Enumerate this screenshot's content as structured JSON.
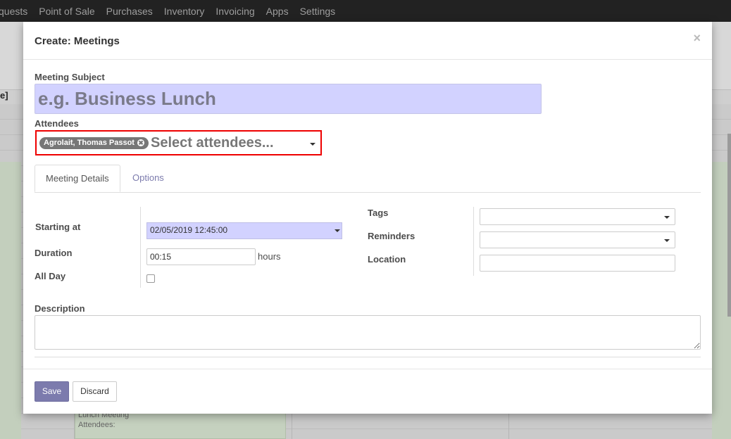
{
  "topnav": {
    "items": [
      "quests",
      "Point of Sale",
      "Purchases",
      "Inventory",
      "Invoicing",
      "Apps",
      "Settings"
    ]
  },
  "background": {
    "bracket_text": "e]",
    "event_title": "Lunch Meeting",
    "event_attendees": "Attendees:"
  },
  "dialog": {
    "title": "Create: Meetings",
    "close": "×",
    "meeting_subject": {
      "label": "Meeting Subject",
      "placeholder": "e.g. Business Lunch",
      "value": ""
    },
    "attendees": {
      "label": "Attendees",
      "tags": [
        "Agrolait, Thomas Passot"
      ],
      "placeholder": "Select attendees..."
    },
    "tabs": [
      {
        "label": "Meeting Details",
        "active": true
      },
      {
        "label": "Options",
        "active": false
      }
    ],
    "starting_at": {
      "label": "Starting at",
      "value": "02/05/2019 12:45:00"
    },
    "duration": {
      "label": "Duration",
      "value": "00:15",
      "unit": "hours"
    },
    "all_day": {
      "label": "All Day",
      "checked": false
    },
    "tags_field": {
      "label": "Tags",
      "value": ""
    },
    "reminders": {
      "label": "Reminders",
      "value": ""
    },
    "location": {
      "label": "Location",
      "value": ""
    },
    "description": {
      "label": "Description",
      "value": ""
    },
    "buttons": {
      "save": "Save",
      "discard": "Discard"
    }
  },
  "colors": {
    "accent": "#7c7bad",
    "required_field": "#d2d2ff",
    "highlight": "#e00000",
    "navbar": "#222222"
  }
}
